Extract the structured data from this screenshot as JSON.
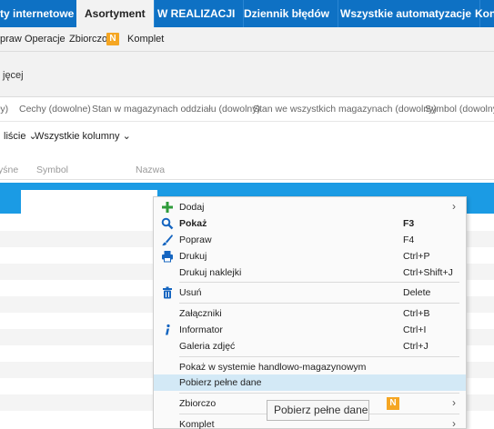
{
  "tabs": [
    {
      "label": "ty internetowe",
      "active": false
    },
    {
      "label": "Asortyment",
      "active": true
    },
    {
      "label": "W REALIZACJI",
      "active": false
    },
    {
      "label": "Dziennik błędów",
      "active": false
    },
    {
      "label": "Wszystkie automatyzacje",
      "active": false
    },
    {
      "label": "Kon",
      "active": false
    }
  ],
  "subbar": {
    "items": [
      "praw",
      "Operacje",
      "Zbiorczo",
      "Komplet"
    ],
    "badge": "N"
  },
  "panel": {
    "text": "jęcej"
  },
  "filters": [
    "ły)",
    "Cechy (dowolne)",
    "Stan w magazynach oddziału (dowolny)",
    "Stan we wszystkich magazynach (dowolny)",
    "Symbol (dowolny)"
  ],
  "options": {
    "view": "liście",
    "columns": "Wszystkie kolumny"
  },
  "columns": [
    "yśne",
    "Symbol",
    "Nazwa"
  ],
  "context_menu": {
    "items": [
      {
        "label": "Dodaj",
        "shortcut": "",
        "submenu": true,
        "icon": "plus-icon"
      },
      {
        "label": "Pokaż",
        "shortcut": "F3",
        "bold": true,
        "icon": "search-icon"
      },
      {
        "label": "Popraw",
        "shortcut": "F4",
        "icon": "brush-icon"
      },
      {
        "label": "Drukuj",
        "shortcut": "Ctrl+P",
        "icon": "printer-icon"
      },
      {
        "label": "Drukuj naklejki",
        "shortcut": "Ctrl+Shift+J"
      },
      {
        "label": "Usuń",
        "shortcut": "Delete",
        "icon": "trash-icon"
      },
      {
        "label": "Załączniki",
        "shortcut": "Ctrl+B"
      },
      {
        "label": "Informator",
        "shortcut": "Ctrl+I",
        "icon": "info-icon"
      },
      {
        "label": "Galeria zdjęć",
        "shortcut": "Ctrl+J"
      },
      {
        "label": "Pokaż w systemie handlowo-magazynowym",
        "shortcut": ""
      },
      {
        "label": "Pobierz pełne dane",
        "shortcut": "",
        "highlighted": true
      },
      {
        "label": "Zbiorczo",
        "badge": "N",
        "submenu": true
      },
      {
        "label": "Komplet",
        "submenu": true
      }
    ],
    "arrow": "›"
  },
  "tooltip": "Pobierz pełne dane",
  "colors": {
    "tab_bar": "#0e71c4",
    "selected_row": "#1b9be4",
    "badge": "#f5a623",
    "menu_highlight": "#d3e9f6",
    "plus_icon": "#2e9b3a",
    "blue_icon": "#1565c0"
  }
}
